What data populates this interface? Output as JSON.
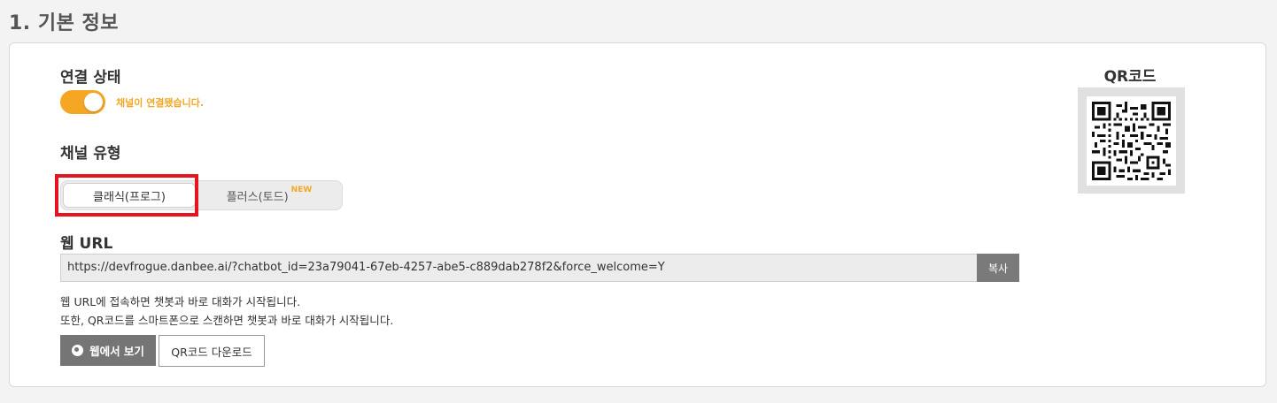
{
  "section_title": "1. 기본 정보",
  "connection": {
    "label": "연결 상태",
    "toggle_on": true,
    "status_text": "채널이 연결됐습니다."
  },
  "channel_type": {
    "label": "채널 유형",
    "options": [
      {
        "label": "클래식(프로그)",
        "selected": true
      },
      {
        "label": "플러스(토드)",
        "badge": "NEW",
        "selected": false
      }
    ]
  },
  "web_url": {
    "label": "웹 URL",
    "value": "https://devfrogue.danbee.ai/?chatbot_id=23a79041-67eb-4257-abe5-c889dab278f2&force_welcome=Y",
    "copy_label": "복사"
  },
  "description": {
    "line1": "웹 URL에 접속하면 챗봇과 바로 대화가 시작됩니다.",
    "line2": "또한, QR코드를 스마트폰으로 스캔하면 챗봇과 바로 대화가 시작됩니다."
  },
  "buttons": {
    "view_web": "웹에서 보기",
    "qr_download": "QR코드 다운로드"
  },
  "qr": {
    "title": "QR코드"
  },
  "colors": {
    "accent": "#f5a623",
    "highlight": "#e5141e",
    "button_gray": "#757575"
  }
}
